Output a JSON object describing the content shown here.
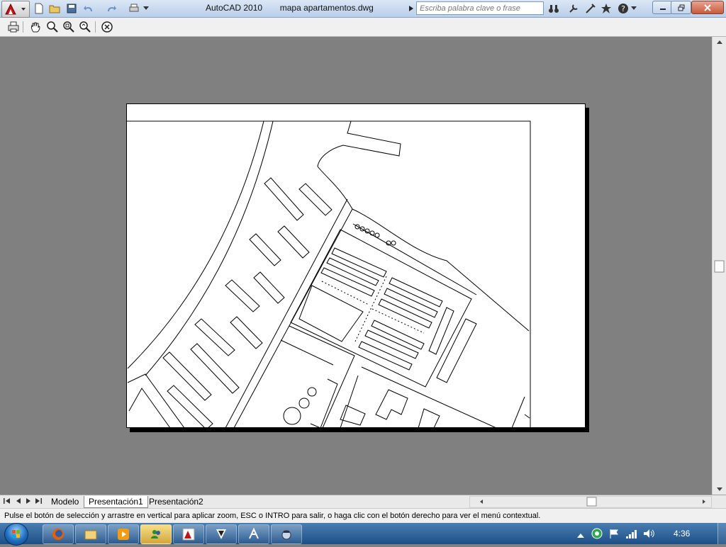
{
  "window": {
    "app_name": "AutoCAD 2010",
    "file_name": "mapa apartamentos.dwg"
  },
  "search": {
    "placeholder": "Escriba palabra clave o frase"
  },
  "layout_tabs": [
    "Modelo",
    "Presentación1",
    "Presentación2"
  ],
  "status": {
    "message": "Pulse el botón de selección y arrastre en vertical para aplicar zoom, ESC o INTRO para salir, o haga clic con el botón derecho para ver el menú contextual."
  },
  "taskbar": {
    "clock": "4:36",
    "apps": [
      "firefox-icon",
      "explorer-icon",
      "media-player-icon",
      "messenger-icon",
      "autocad-icon",
      "app-icon",
      "design-icon",
      "app2-icon"
    ]
  },
  "colors": {
    "canvas_bg": "#808080",
    "paper": "#ffffff",
    "taskbar": "#1d4f86"
  }
}
